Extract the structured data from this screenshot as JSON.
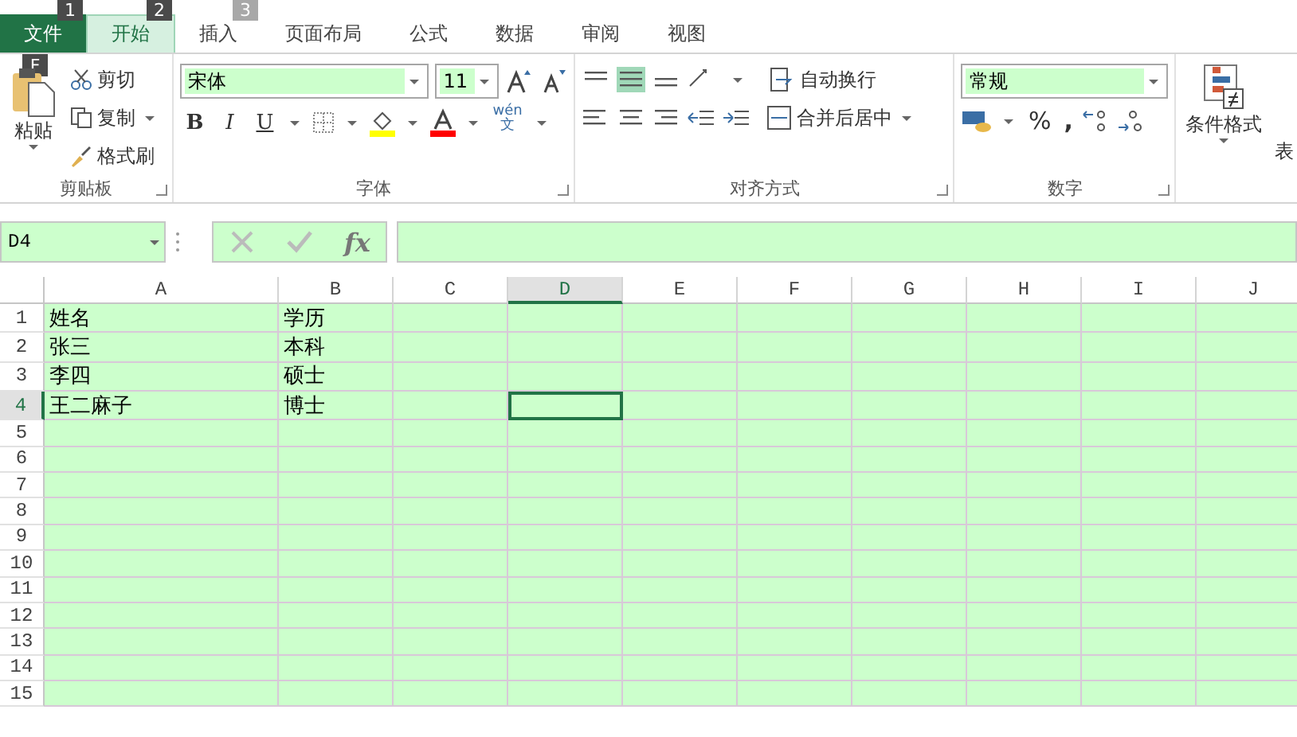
{
  "tabs": [
    {
      "label": "文件",
      "kind": "file",
      "keytip": "1",
      "selected": false
    },
    {
      "label": "开始",
      "kind": "tab",
      "keytip": "2",
      "selected": true
    },
    {
      "label": "插入",
      "kind": "tab",
      "keytip": "3",
      "selected": false
    },
    {
      "label": "页面布局",
      "kind": "tab",
      "selected": false
    },
    {
      "label": "公式",
      "kind": "tab",
      "selected": false
    },
    {
      "label": "数据",
      "kind": "tab",
      "selected": false
    },
    {
      "label": "审阅",
      "kind": "tab",
      "selected": false
    },
    {
      "label": "视图",
      "kind": "tab",
      "selected": false
    }
  ],
  "paste_keytip": "F",
  "clipboard": {
    "paste": "粘贴",
    "cut": "剪切",
    "copy": "复制",
    "format_painter": "格式刷",
    "label": "剪贴板"
  },
  "font": {
    "name": "宋体",
    "size": "11",
    "bold": "B",
    "italic": "I",
    "underline": "U",
    "phonetic": "wén",
    "phonetic_char": "文",
    "label": "字体"
  },
  "alignment": {
    "wrap": "自动换行",
    "merge": "合并后居中",
    "label": "对齐方式"
  },
  "number": {
    "format": "常规",
    "percent": "%",
    "comma": ",",
    "label": "数字"
  },
  "styles": {
    "conditional": "条件格式",
    "cut_label": "表"
  },
  "formula_bar": {
    "name_box": "D4",
    "fx": "fx"
  },
  "columns": [
    {
      "label": "A",
      "selected": false
    },
    {
      "label": "B",
      "selected": false
    },
    {
      "label": "C",
      "selected": false
    },
    {
      "label": "D",
      "selected": true
    },
    {
      "label": "E",
      "selected": false
    },
    {
      "label": "F",
      "selected": false
    },
    {
      "label": "G",
      "selected": false
    },
    {
      "label": "H",
      "selected": false
    },
    {
      "label": "I",
      "selected": false
    },
    {
      "label": "J",
      "selected": false
    }
  ],
  "rows": [
    {
      "label": "1",
      "selected": false,
      "cells": [
        "姓名",
        "学历"
      ]
    },
    {
      "label": "2",
      "selected": false,
      "cells": [
        "张三",
        "本科"
      ]
    },
    {
      "label": "3",
      "selected": false,
      "cells": [
        "李四",
        "硕士"
      ]
    },
    {
      "label": "4",
      "selected": true,
      "cells": [
        "王二麻子",
        "博士"
      ]
    },
    {
      "label": "5",
      "selected": false,
      "cells": []
    },
    {
      "label": "6",
      "selected": false,
      "cells": []
    },
    {
      "label": "7",
      "selected": false,
      "cells": []
    },
    {
      "label": "8",
      "selected": false,
      "cells": []
    },
    {
      "label": "9",
      "selected": false,
      "cells": []
    },
    {
      "label": "10",
      "selected": false,
      "cells": []
    },
    {
      "label": "11",
      "selected": false,
      "cells": []
    },
    {
      "label": "12",
      "selected": false,
      "cells": []
    },
    {
      "label": "13",
      "selected": false,
      "cells": []
    },
    {
      "label": "14",
      "selected": false,
      "cells": []
    },
    {
      "label": "15",
      "selected": false,
      "cells": []
    }
  ]
}
